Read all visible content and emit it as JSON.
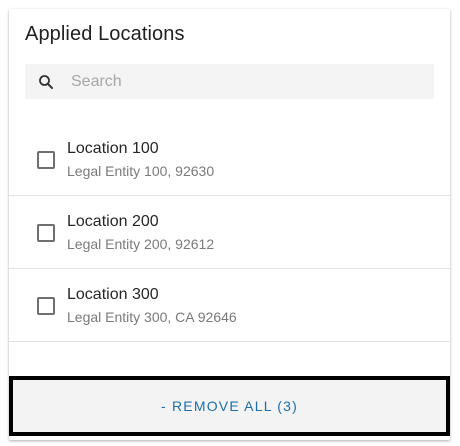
{
  "panel": {
    "title": "Applied Locations"
  },
  "search": {
    "placeholder": "Search",
    "value": "",
    "icon": "search-icon"
  },
  "locations": [
    {
      "name": "Location 100",
      "detail": "Legal Entity 100, 92630",
      "checked": false
    },
    {
      "name": "Location 200",
      "detail": "Legal Entity 200, 92612",
      "checked": false
    },
    {
      "name": "Location 300",
      "detail": "Legal Entity 300, CA 92646",
      "checked": false
    }
  ],
  "footer": {
    "remove_all_label": "- REMOVE ALL (3)"
  },
  "colors": {
    "accent": "#1e6fa8",
    "text_primary": "#262626",
    "text_secondary": "#7a7a7a",
    "search_bg": "#f4f4f4",
    "footer_bg": "#f3f3f3"
  }
}
